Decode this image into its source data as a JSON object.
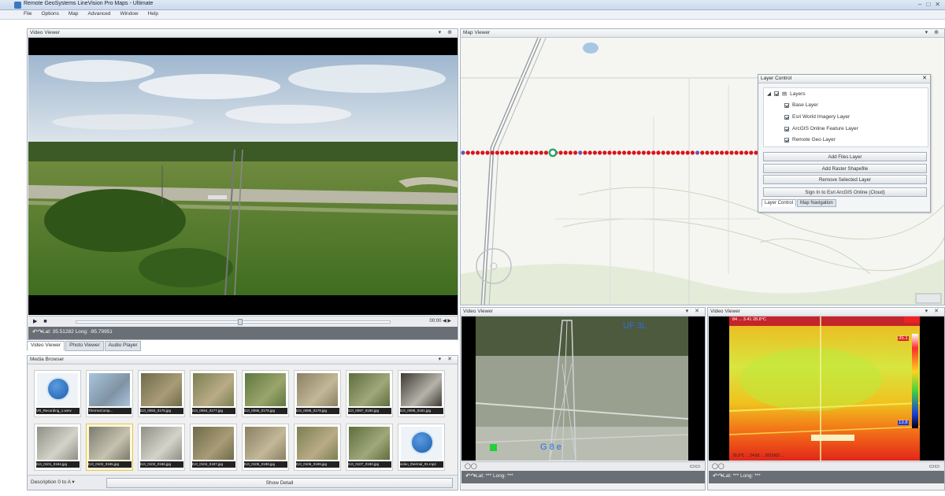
{
  "window": {
    "title": "Remote GeoSystems LineVision Pro Maps - Ultimate",
    "controls": [
      "–",
      "□",
      "✕"
    ]
  },
  "menu": [
    "File",
    "Options",
    "Map",
    "Advanced",
    "Window",
    "Help"
  ],
  "video_viewer_main": {
    "title": "Video Viewer",
    "pin_controls": "▾ ⊕",
    "coords": "Lat: 35.51282   Long: -95.79951",
    "rate": "00:00  ◀  ▶"
  },
  "video_tabs": [
    {
      "label": "Video Viewer",
      "active": true
    },
    {
      "label": "Photo Viewer",
      "active": false
    },
    {
      "label": "Audio Player",
      "active": false
    }
  ],
  "media_browser": {
    "title": "Media Browser",
    "pin_controls": "▾ ✕",
    "items": [
      {
        "caption": "VR_Recording_1.wmv",
        "kind": "video"
      },
      {
        "caption": "ThermoComp...",
        "kind": "sky"
      },
      {
        "caption": "DJI_0093_0176.jpg",
        "kind": "aerial1"
      },
      {
        "caption": "DJI_0094_0177.jpg",
        "kind": "aerial2"
      },
      {
        "caption": "DJI_0095_0178.jpg",
        "kind": "aerial3"
      },
      {
        "caption": "DJI_0096_0179.jpg",
        "kind": "aerial4"
      },
      {
        "caption": "DJI_0097_0180.jpg",
        "kind": "aerial5"
      },
      {
        "caption": "DJI_0098_0181.jpg",
        "kind": "tower"
      },
      {
        "caption": "DJI_0101_0184.jpg",
        "kind": "tower2"
      },
      {
        "caption": "DJI_0102_0185.jpg",
        "kind": "tower3"
      },
      {
        "caption": "DJI_0103_0186.jpg",
        "kind": "tower2"
      },
      {
        "caption": "DJI_0104_0187.jpg",
        "kind": "aerial1"
      },
      {
        "caption": "DJI_0105_0188.jpg",
        "kind": "aerial4"
      },
      {
        "caption": "DJI_0106_0189.jpg",
        "kind": "aerial2"
      },
      {
        "caption": "DJI_0107_0190.jpg",
        "kind": "aerial5"
      },
      {
        "caption": "video_thermal_01.mp4",
        "kind": "video"
      }
    ],
    "description_selector": "Description 0 to A",
    "show_detail": "Show Detail"
  },
  "map_viewer": {
    "title": "Map Viewer",
    "pin_controls": "▾ ⊕"
  },
  "layer_control": {
    "title": "Layer Control",
    "root": "Layers",
    "layers": [
      "Base Layer",
      "Esri World Imagery Layer",
      "ArcGIS Online Feature Layer",
      "Remote Geo Layer"
    ],
    "buttons": [
      "Add Files Layer",
      "Add Raster Shapefile",
      "Remove Selected Layer",
      "Sign In to Esri ArcGIS Online (Cloud)"
    ],
    "tabs": [
      "Layer Control",
      "Map Navigation"
    ]
  },
  "video_viewer_2": {
    "title": "Video Viewer",
    "pin_controls": "▾ ✕",
    "overlay_top": "UF 3L",
    "overlay_bottom": "G 8 e",
    "coords": "Lat: ***   Long: ***"
  },
  "video_viewer_3": {
    "title": "Video Viewer",
    "pin_controls": "▾ ✕",
    "overlay_top": "84 ... 3.41   28.8°C",
    "overlay_bottom": "20.5°C ... 24.81 ... 2015/03 ...",
    "scale_high": "35.1",
    "scale_low": "13.8",
    "coords": "Lat: ***   Long: ***"
  },
  "colors": {
    "track_point": "#d7151b",
    "track_marker": "#6b54b5",
    "track_selected": "#29a36a"
  }
}
